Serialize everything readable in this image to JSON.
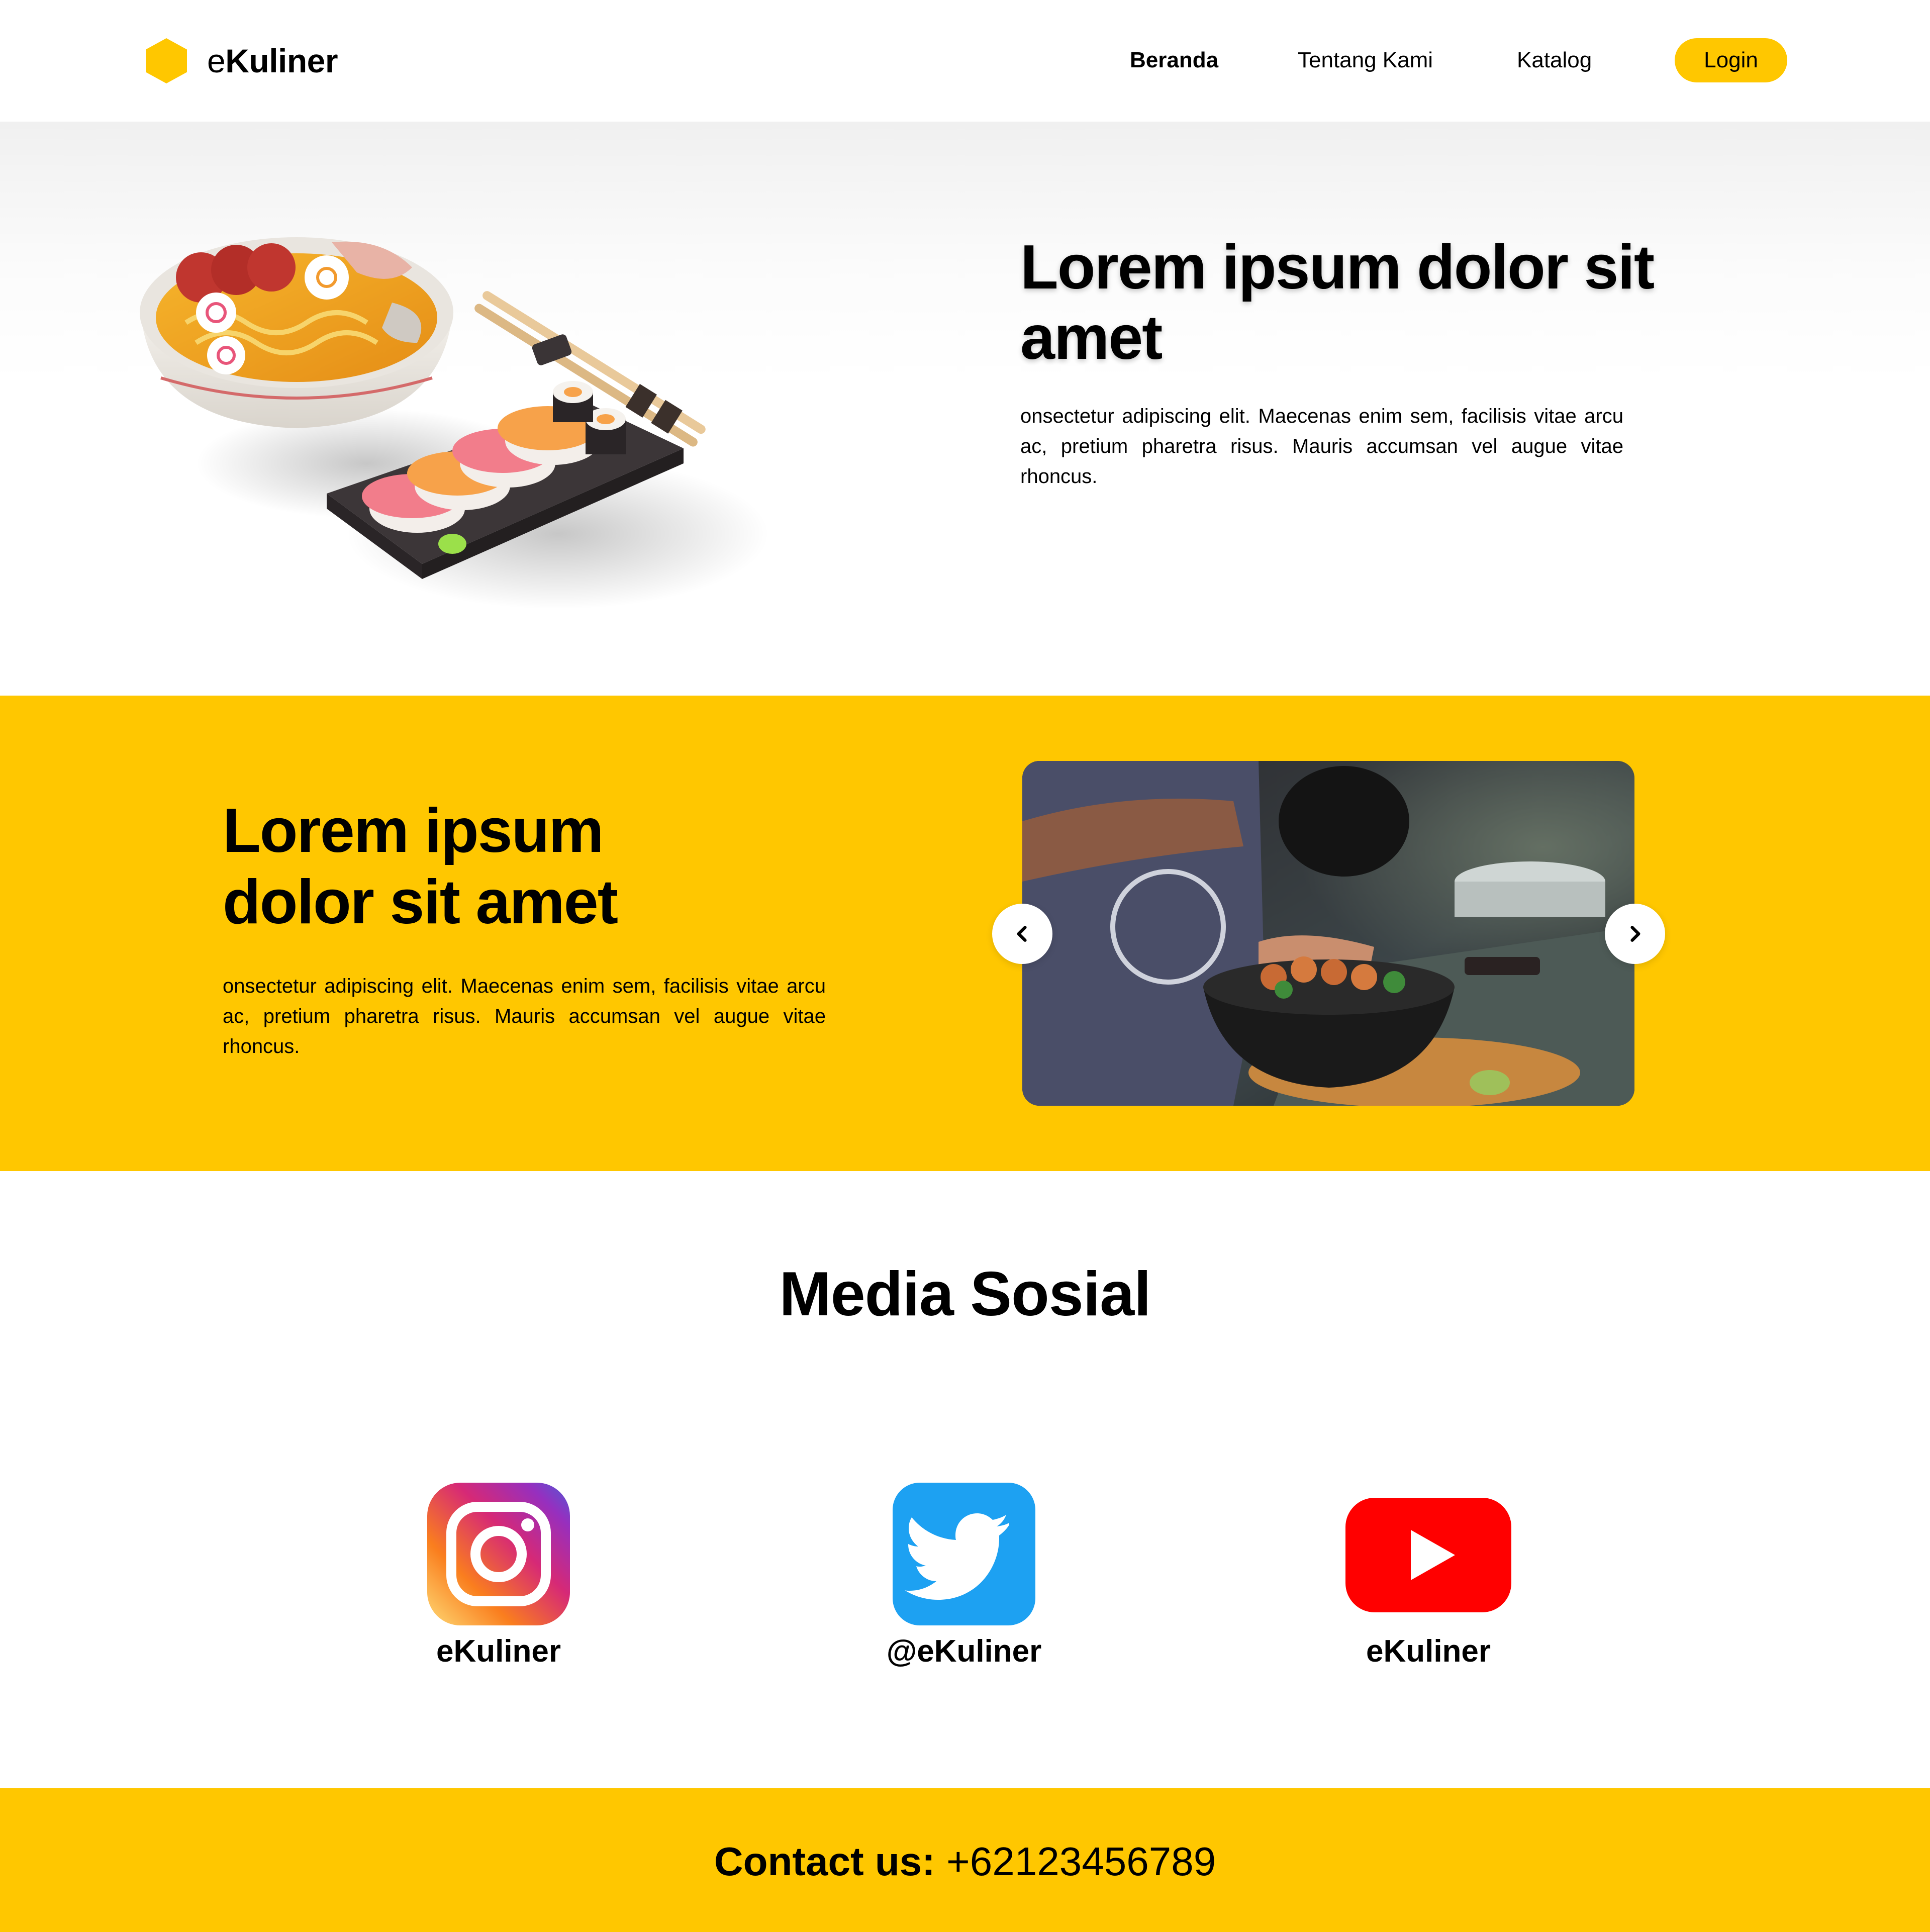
{
  "brand": {
    "prefix": "e",
    "name": "Kuliner"
  },
  "nav": {
    "items": [
      {
        "label": "Beranda",
        "active": true
      },
      {
        "label": "Tentang Kami",
        "active": false
      },
      {
        "label": "Katalog",
        "active": false
      }
    ],
    "login_label": "Login"
  },
  "hero": {
    "title": "Lorem ipsum dolor sit amet",
    "text": "onsectetur adipiscing elit. Maecenas enim sem, facilisis vitae arcu ac, pretium pharetra risus. Mauris accumsan vel augue vitae rhoncus."
  },
  "feature": {
    "title": "Lorem ipsum dolor sit amet",
    "text": "onsectetur adipiscing elit. Maecenas enim sem, facilisis vitae arcu ac, pretium pharetra risus. Mauris accumsan vel augue vitae rhoncus."
  },
  "social": {
    "title": "Media Sosial",
    "items": [
      {
        "icon": "instagram-icon",
        "handle": "eKuliner"
      },
      {
        "icon": "twitter-icon",
        "handle": "@eKuliner"
      },
      {
        "icon": "youtube-icon",
        "handle": "eKuliner"
      }
    ]
  },
  "footer": {
    "contact_label": "Contact us:",
    "phone": "+62123456789"
  },
  "colors": {
    "accent": "#FFC700",
    "text": "#000000",
    "twitter": "#1DA1F2",
    "youtube": "#FF0000"
  }
}
